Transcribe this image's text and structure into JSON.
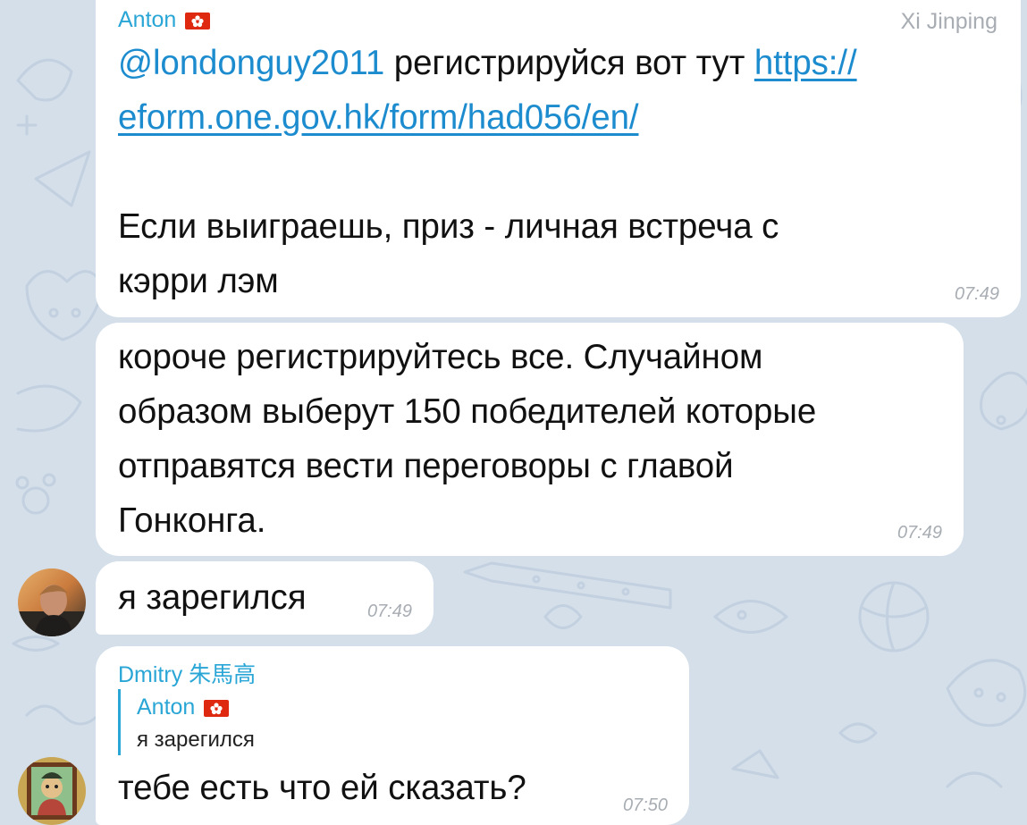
{
  "messages": [
    {
      "sender": "Anton",
      "forwarded_from": "Xi Jinping",
      "mention": "@londonguy2011",
      "text_after_mention": " регистрируйся вот тут ",
      "link_part1": "https://",
      "link_part2": "eform.one.gov.hk/form/had056/en/",
      "line3": "Если выиграешь, приз - личная встреча с",
      "line4": "кэрри лэм",
      "time": "07:49"
    },
    {
      "lines": [
        "короче регистрируйтесь все. Случайном",
        "образом выберут 150 победителей которые",
        "отправятся вести переговоры с главой",
        "Гонконга."
      ],
      "time": "07:49"
    },
    {
      "text": "я зарегился",
      "time": "07:49"
    },
    {
      "sender": "Dmitry 朱馬高",
      "reply_sender": "Anton",
      "reply_text": "я зарегился",
      "text": "тебе есть что ей сказать?",
      "time": "07:50"
    }
  ],
  "colors": {
    "background": "#d4dfea",
    "bubble": "#ffffff",
    "accent": "#2aa6d6",
    "link": "#1c8ccf",
    "timestamp": "#a8adb3"
  },
  "icons": [
    "hong-kong-flag-icon",
    "avatar-photo",
    "avatar-painting"
  ]
}
